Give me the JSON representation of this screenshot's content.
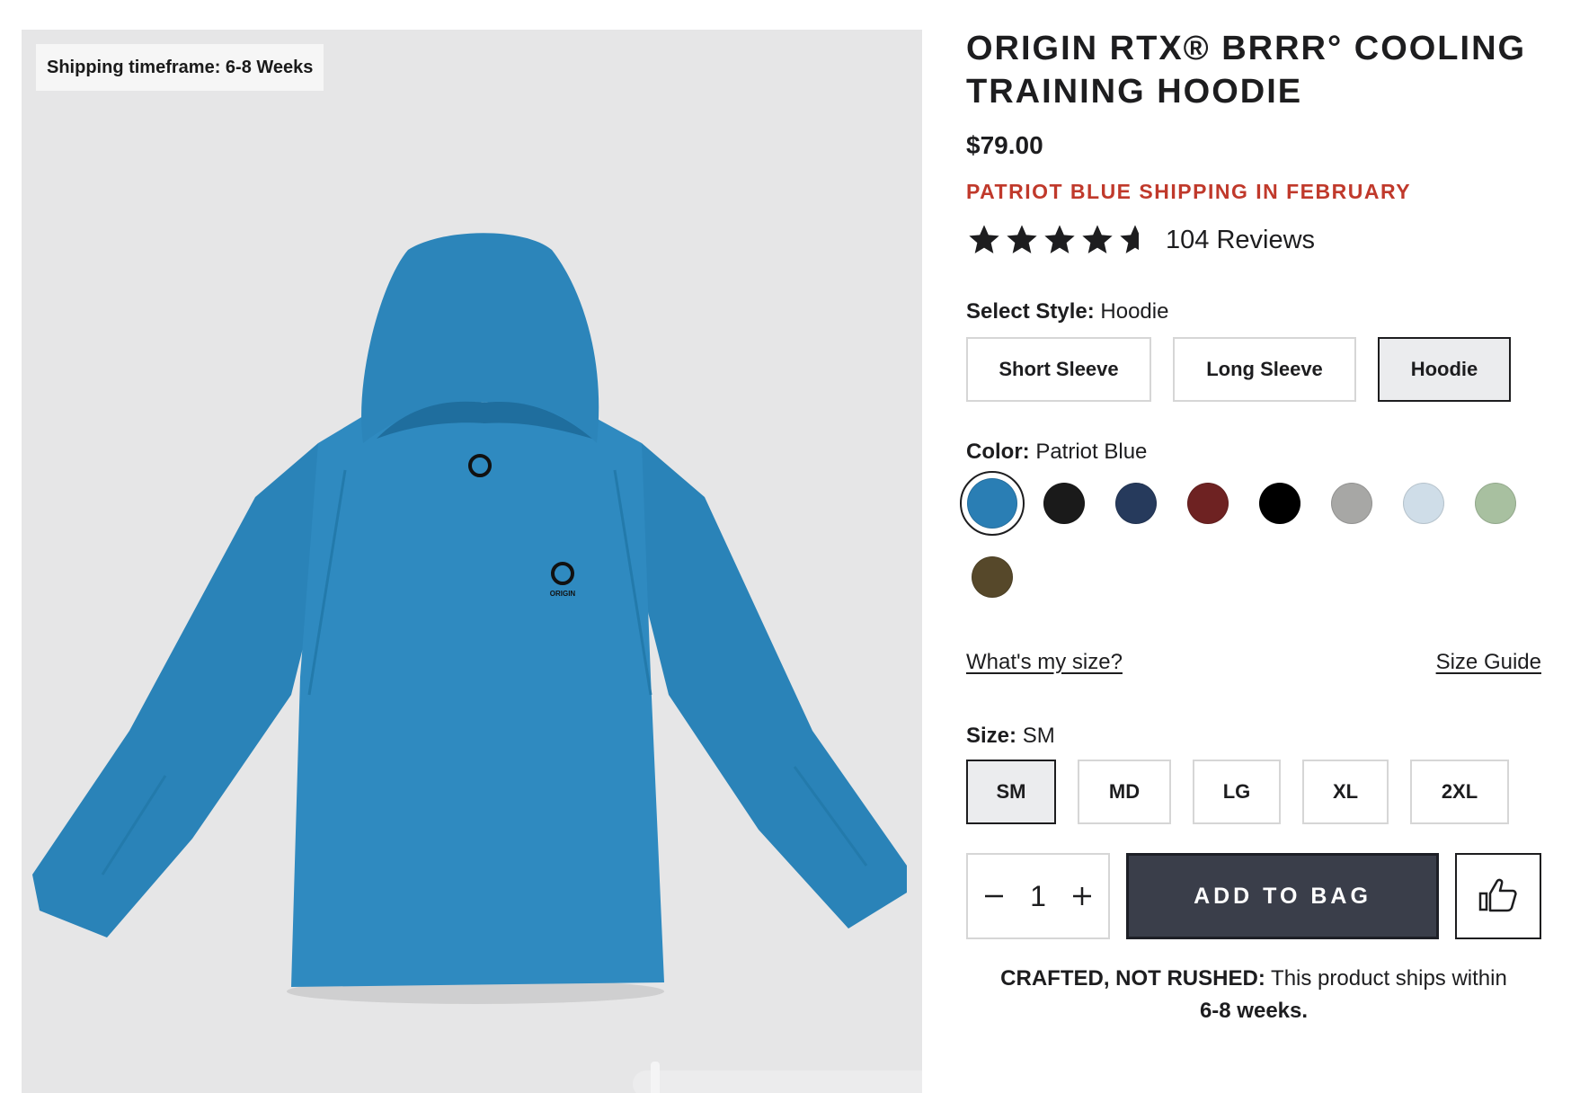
{
  "gallery": {
    "shipping_badge": "Shipping timeframe: 6-8 Weeks",
    "logo_text": "ORIGIN"
  },
  "product": {
    "title": "ORIGIN RTX® BRRR° COOLING TRAINING HOODIE",
    "price": "$79.00",
    "shipping_note": "PATRIOT BLUE SHIPPING IN FEBRUARY",
    "rating": 4.5,
    "reviews_label": "104 Reviews"
  },
  "style": {
    "label": "Select Style:",
    "selected": "Hoodie",
    "options": [
      "Short Sleeve",
      "Long Sleeve",
      "Hoodie"
    ]
  },
  "color": {
    "label": "Color:",
    "selected": "Patriot Blue",
    "swatches": [
      "#2a7eb4",
      "#1a1a1a",
      "#263a5c",
      "#6e2222",
      "#000000",
      "#a7a7a5",
      "#cfdde8",
      "#a8c0a0",
      "#56482a"
    ]
  },
  "links": {
    "whats_my_size": "What's my size?",
    "size_guide": "Size Guide"
  },
  "size": {
    "label": "Size:",
    "selected": "SM",
    "options": [
      "SM",
      "MD",
      "LG",
      "XL",
      "2XL"
    ]
  },
  "cart": {
    "quantity": "1",
    "minus_icon": "minus-icon",
    "plus_icon": "plus-icon",
    "add_label": "ADD TO BAG",
    "like_icon": "thumbs-up-icon"
  },
  "crafted": {
    "bold": "CRAFTED, NOT RUSHED:",
    "text": " This product ships within",
    "weeks": "6-8 weeks."
  },
  "colors": {
    "accent_red": "#c0392b",
    "button_dark": "#3a3e4a",
    "hoodie_blue": "#2a7eb4"
  }
}
